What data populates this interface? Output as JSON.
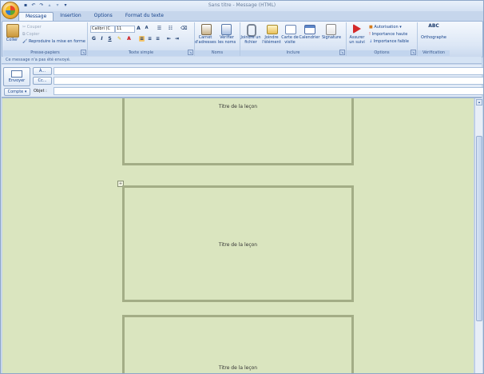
{
  "window": {
    "title": "Sans titre - Message (HTML)"
  },
  "tabs": [
    "Message",
    "Insertion",
    "Options",
    "Format du texte"
  ],
  "ribbon": {
    "clipboard": {
      "paste": "Coller",
      "cut": "Couper",
      "copy": "Copier",
      "format_painter": "Reproduire la mise en forme",
      "label": "Presse-papiers"
    },
    "basic_text": {
      "font": "Calibri (C",
      "size": "11",
      "label": "Texte simple"
    },
    "names": {
      "address_book": "Carnet d'adresses",
      "check_names": "Vérifier les noms",
      "label": "Noms"
    },
    "include": {
      "attach_file": "Joindre un fichier",
      "attach_item": "Joindre l'élément",
      "business_card": "Carte de visite",
      "calendar": "Calendrier",
      "signature": "Signature",
      "label": "Inclure"
    },
    "options": {
      "follow_up": "Assurer un suivi",
      "permission": "Autorisation",
      "high": "Importance haute",
      "low": "Importance faible",
      "label": "Options"
    },
    "proofing": {
      "spelling": "Orthographe",
      "abc": "ABC",
      "label": "Vérification"
    }
  },
  "infobar": "Ce message n'a pas été envoyé.",
  "header": {
    "send": "Envoyer",
    "to": "À...",
    "cc": "Cc...",
    "account": "Compte",
    "subject_label": "Objet :",
    "to_value": "",
    "cc_value": "",
    "subject_value": ""
  },
  "body": {
    "frames": [
      "Titre de la leçon",
      "Titre de la leçon",
      "Titre de la leçon"
    ]
  }
}
